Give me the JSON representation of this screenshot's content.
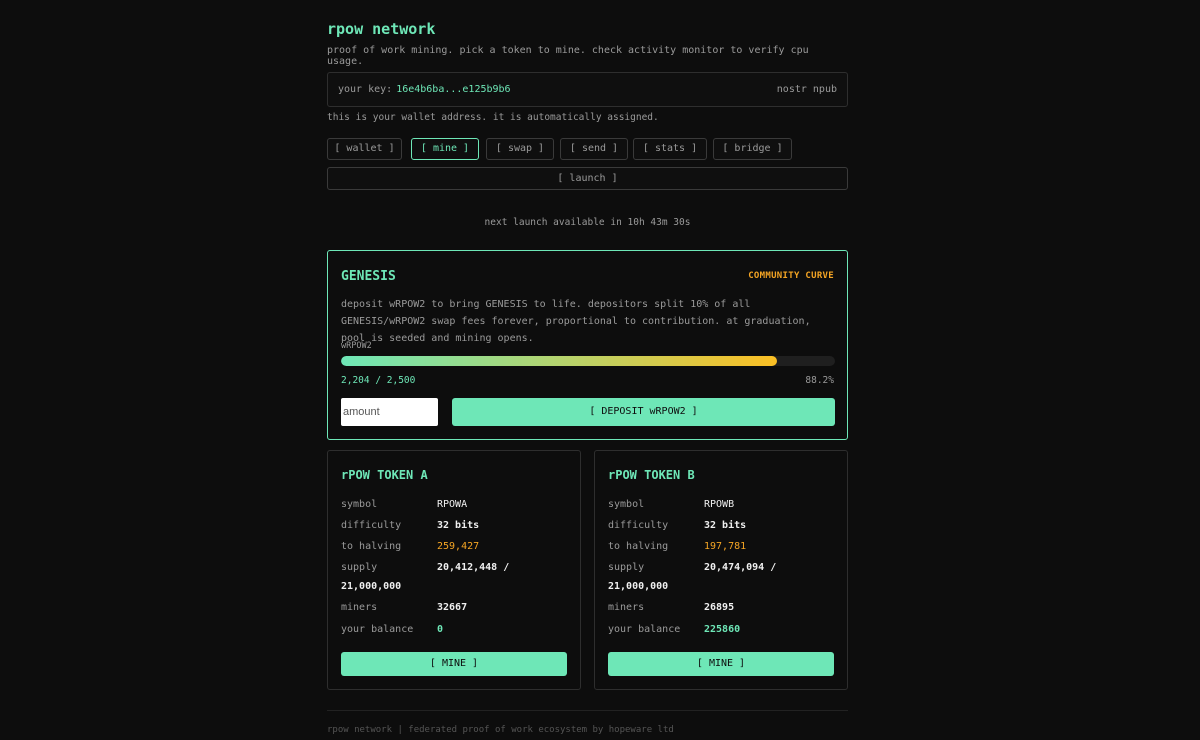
{
  "header": {
    "title": "rpow network",
    "subtitle": "proof of work mining. pick a token to mine. check activity monitor to verify cpu usage."
  },
  "key": {
    "label": "your key:",
    "value": "16e4b6ba...e125b9b6",
    "npub_label": "nostr npub",
    "note": "this is your wallet address. it is automatically assigned."
  },
  "tabs": [
    {
      "label": "[ wallet ]"
    },
    {
      "label": "[ mine ]"
    },
    {
      "label": "[ swap ]"
    },
    {
      "label": "[ send ]"
    },
    {
      "label": "[ stats ]"
    },
    {
      "label": "[ bridge ]"
    }
  ],
  "launch": {
    "label": "[ launch ]",
    "next": "next launch available in 10h 43m 30s"
  },
  "genesis": {
    "title": "GENESIS",
    "badge": "COMMUNITY CURVE",
    "description": "deposit wRPOW2 to bring GENESIS to life. depositors split 10% of all GENESIS/wRPOW2 swap fees forever, proportional to contribution. at graduation, pool is seeded and mining opens.",
    "token_label": "wRPOW2",
    "progress_fraction": 0.882,
    "progress_text": "2,204 / 2,500",
    "percent_text": "88.2%",
    "amount_placeholder": "amount",
    "deposit_label": "[ DEPOSIT wRPOW2 ]"
  },
  "tokens": [
    {
      "title": "rPOW TOKEN A",
      "symbol_label": "symbol",
      "symbol": "RPOWA",
      "difficulty_label": "difficulty",
      "difficulty": "32 bits",
      "halving_label": "to halving",
      "halving": "259,427",
      "supply_label": "supply",
      "supply_a": "20,412,448 /",
      "supply_b": "21,000,000",
      "miners_label": "miners",
      "miners": "32667",
      "balance_label": "your balance",
      "balance": "0",
      "mine_label": "[ MINE ]"
    },
    {
      "title": "rPOW TOKEN B",
      "symbol_label": "symbol",
      "symbol": "RPOWB",
      "difficulty_label": "difficulty",
      "difficulty": "32 bits",
      "halving_label": "to halving",
      "halving": "197,781",
      "supply_label": "supply",
      "supply_a": "20,474,094 /",
      "supply_b": "21,000,000",
      "miners_label": "miners",
      "miners": "26895",
      "balance_label": "your balance",
      "balance": "225860",
      "mine_label": "[ MINE ]"
    }
  ],
  "footer": "rpow network | federated proof of work ecosystem by hopeware ltd"
}
